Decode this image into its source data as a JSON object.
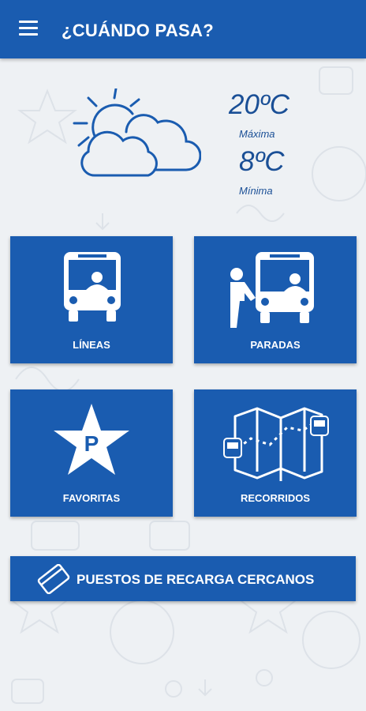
{
  "header": {
    "title": "¿CUÁNDO PASA?",
    "menu_icon": "hamburger-menu-icon"
  },
  "weather": {
    "icon": "partly-cloudy-icon",
    "max_temp": "20ºC",
    "max_label": "Máxima",
    "min_temp": "8ºC",
    "min_label": "Mínima"
  },
  "tiles": [
    {
      "label": "LÍNEAS",
      "icon": "bus-icon"
    },
    {
      "label": "PARADAS",
      "icon": "bus-stop-icon"
    },
    {
      "label": "FAVORITAS",
      "icon": "star-parking-icon"
    },
    {
      "label": "RECORRIDOS",
      "icon": "route-map-icon"
    }
  ],
  "recharge": {
    "label": "PUESTOS DE RECARGA CERCANOS",
    "icon": "card-icon"
  },
  "colors": {
    "primary": "#1a5cb0",
    "text_dark": "#1a4f96",
    "background": "#eef1f4"
  }
}
